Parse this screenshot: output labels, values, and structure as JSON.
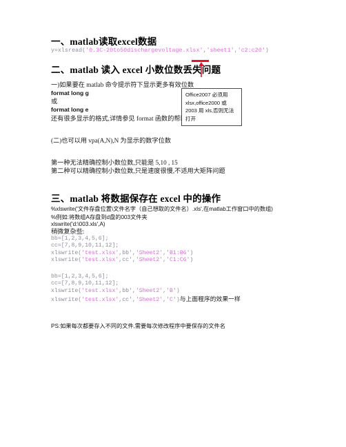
{
  "document": {
    "sections": [
      {
        "id": "section-1",
        "heading": "一、matlab读取excel数据",
        "code_line": {
          "prefix": "y=xlsread(",
          "arg1": "'0.3C-20to50dischargevoltage.xlsx'",
          "sep1": ",",
          "arg2": "'sheet1'",
          "sep2": ",",
          "arg3": "'c2:c20'",
          "suffix": ")"
        }
      },
      {
        "id": "section-2",
        "heading": "二、matlab 读入 excel 小数位数丢失问题",
        "lines": [
          "一)如果要在 matlab 命令提示符下显示更多有效位数",
          "format long g",
          "或",
          "format long e",
          "还有很多显示的格式,详情参见 format 函数的帮助",
          "(二)也可以用 vpa(A,N),N 为显示的数字位数",
          "第一种无法精确控制小数位数,只能是 5,10 , 15",
          "第二种可以精确控制小数位数,只是速度很慢,不适用大矩阵问题"
        ]
      },
      {
        "id": "section-3",
        "heading": "三、matlab 将数据保存在 excel 中的操作",
        "comment_1": "%xlswrite('文件存盘位置\\文件名字（自己想取的文件名）.xls',在matlab工作窗口中的数组)",
        "comment_2": "%例如:将数组A存盘到d盘的003文件夹",
        "plain_code": "xlswrite('d:\\003.xls',A)",
        "note": "稍微复杂些:",
        "block_1": [
          {
            "plain_a": "bb=[1,2,3,4,5,6];",
            "type": "plain"
          },
          {
            "plain_a": "cc=[7,8,9,10,11,12];",
            "type": "plain"
          },
          {
            "type": "call",
            "pre": "xlswrite(",
            "s1": "'test.xlsx'",
            "m1": ",bb',",
            "s2": "'Sheet2'",
            "m2": ",",
            "s3": "'B1:B6'",
            "post": ")"
          },
          {
            "type": "call",
            "pre": "xlswrite(",
            "s1": "'test.xlsx'",
            "m1": ",cc',",
            "s2": "'Sheet2'",
            "m2": ",",
            "s3": "'C1:C6'",
            "post": ")"
          }
        ],
        "block_2": [
          {
            "plain_a": "bb=[1,2,3,4,5,6];",
            "type": "plain"
          },
          {
            "plain_a": "cc=[7,8,9,10,11,12];",
            "type": "plain"
          },
          {
            "type": "call",
            "pre": "xlswrite(",
            "s1": "'test.xlsx'",
            "m1": ",bb',",
            "s2": "'Sheet2'",
            "m2": ",",
            "s3": "'B'",
            "post": ")"
          },
          {
            "type": "call",
            "pre": "xlswrite(",
            "s1": "'test.xlsx'",
            "m1": ",cc',",
            "s2": "'Sheet2'",
            "m2": ",",
            "s3": "'C'",
            "post": ")",
            "trailing": "与上面程序的效果一样"
          }
        ],
        "ps": "PS:如果每次都要存入不同的文件,需要每次修改程序中要保存的文件名"
      }
    ],
    "callout": {
      "text": "Office2007 必须用 xlsx,office2000 或 2003 用 xls,否则无法打开"
    },
    "annotation": {
      "name": "red-underline-arrow",
      "color": "#e8112d",
      "target": ".xlsx"
    }
  }
}
